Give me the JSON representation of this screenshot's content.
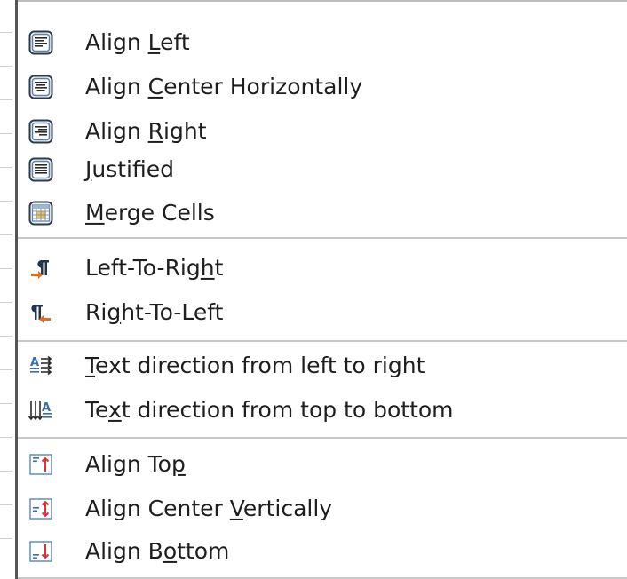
{
  "menu": {
    "items": [
      {
        "label": "Align Left",
        "icon": "align-left-icon"
      },
      {
        "label": "Align Center Horizontally",
        "icon": "align-center-horizontally-icon"
      },
      {
        "label": "Align Right",
        "icon": "align-right-icon"
      },
      {
        "label": "Justified",
        "icon": "justified-icon"
      },
      {
        "label": "Merge Cells",
        "icon": "merge-cells-icon"
      },
      {
        "label": "Left-To-Right",
        "icon": "left-to-right-icon"
      },
      {
        "label": "Right-To-Left",
        "icon": "right-to-left-icon"
      },
      {
        "label": "Text direction from left to right",
        "icon": "text-direction-left-to-right-icon"
      },
      {
        "label": "Text direction from top to bottom",
        "icon": "text-direction-top-to-bottom-icon"
      },
      {
        "label": "Align Top",
        "icon": "align-top-icon"
      },
      {
        "label": "Align Center Vertically",
        "icon": "align-center-vertically-icon"
      },
      {
        "label": "Align Bottom",
        "icon": "align-bottom-icon"
      }
    ],
    "mnemonics": [
      "L",
      "C",
      "R",
      "J",
      "M",
      "h",
      "g",
      "T",
      "x",
      "p",
      "V",
      "o"
    ]
  },
  "colors": {
    "icon_blue": "#3a6ea5",
    "icon_border": "#2f3b48",
    "arrow_orange": "#e86a1a",
    "arrow_red": "#e03030"
  }
}
